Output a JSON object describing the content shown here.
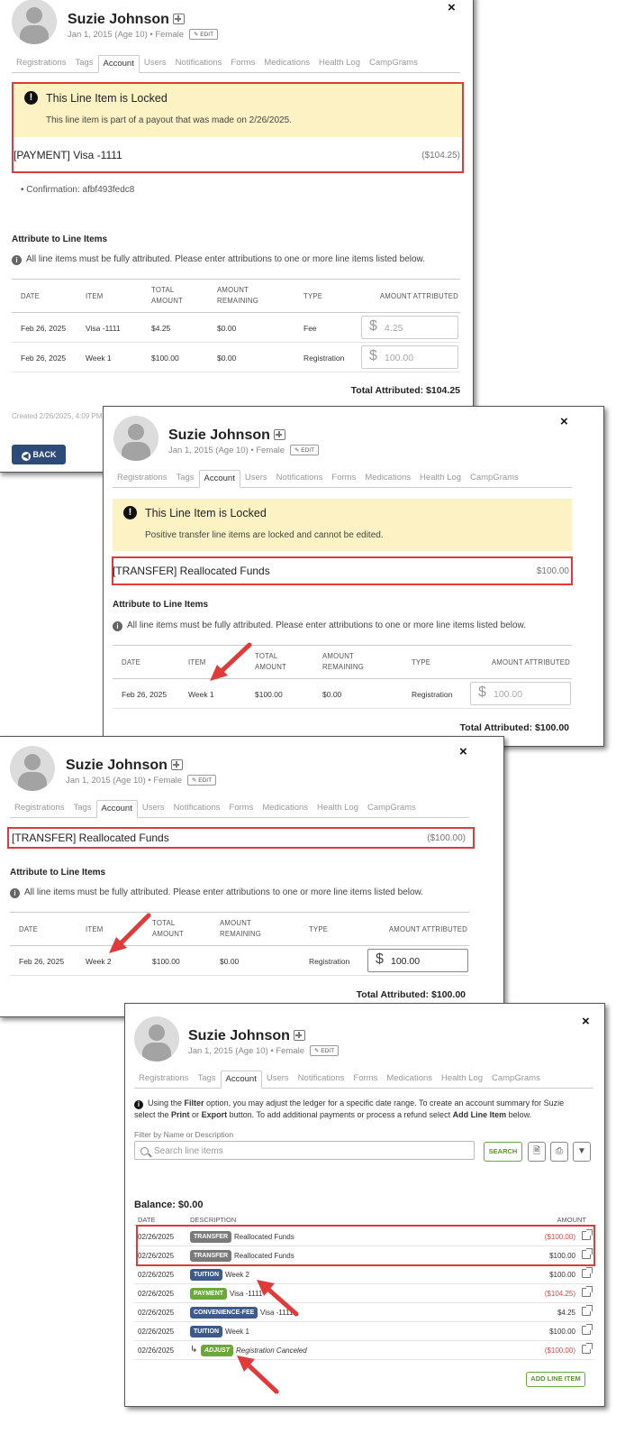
{
  "person": {
    "name": "Suzie Johnson",
    "meta": "Jan 1, 2015 (Age 10) • Female",
    "edit_label": "EDIT"
  },
  "tabs": [
    "Registrations",
    "Tags",
    "Account",
    "Users",
    "Notifications",
    "Forms",
    "Medications",
    "Health Log",
    "CampGrams"
  ],
  "close_label": "×",
  "attribute_title": "Attribute to Line Items",
  "attribute_note": "All line items must be fully attributed. Please enter attributions to one or more line items listed below.",
  "table_headers": {
    "date": "DATE",
    "item": "ITEM",
    "total_amount": [
      "TOTAL",
      "AMOUNT"
    ],
    "amount_remaining": [
      "AMOUNT",
      "REMAINING"
    ],
    "type": "TYPE",
    "amount_attributed": "AMOUNT ATTRIBUTED"
  },
  "panel1": {
    "locked_title": "This Line Item is Locked",
    "locked_message": "This line item is part of a payout that was made on 2/26/2025.",
    "line_item": "[PAYMENT] Visa -1111",
    "line_amount": "($104.25)",
    "confirmation": "• Confirmation: afbf493fedc8",
    "rows": [
      {
        "date": "Feb 26, 2025",
        "item": "Visa -1111",
        "total": "$4.25",
        "remaining": "$0.00",
        "type": "Fee",
        "attributed": "4.25"
      },
      {
        "date": "Feb 26, 2025",
        "item": "Week 1",
        "total": "$100.00",
        "remaining": "$0.00",
        "type": "Registration",
        "attributed": "100.00"
      }
    ],
    "total_attributed": "Total Attributed: $104.25",
    "created": "Created 2/26/2025, 4:09 PM",
    "back_label": "BACK"
  },
  "panel2": {
    "locked_title": "This Line Item is Locked",
    "locked_message": "Positive transfer line items are locked and cannot be edited.",
    "line_item": "[TRANSFER] Reallocated Funds",
    "line_amount": "$100.00",
    "rows": [
      {
        "date": "Feb 26, 2025",
        "item": "Week 1",
        "total": "$100.00",
        "remaining": "$0.00",
        "type": "Registration",
        "attributed": "100.00"
      }
    ],
    "total_attributed": "Total Attributed: $100.00"
  },
  "panel3": {
    "line_item": "[TRANSFER] Reallocated Funds",
    "line_amount": "($100.00)",
    "rows": [
      {
        "date": "Feb 26, 2025",
        "item": "Week 2",
        "total": "$100.00",
        "remaining": "$0.00",
        "type": "Registration",
        "attributed": "100.00"
      }
    ],
    "total_attributed": "Total Attributed: $100.00"
  },
  "panel4": {
    "note_parts": {
      "a": "Using the ",
      "b": "Filter",
      "c": " option, you may adjust the ledger for a specific date range. To create an account summary for Suzie select the ",
      "d": "Print",
      "e": " or ",
      "f": "Export",
      "g": " button. To add additional payments or process a refund select ",
      "h": "Add Line Item",
      "i": " below."
    },
    "filter_label": "Filter by Name or Description",
    "search_placeholder": "Search line items",
    "search_button": "SEARCH",
    "balance": "Balance: $0.00",
    "headers": {
      "date": "DATE",
      "description": "DESCRIPTION",
      "amount": "AMOUNT"
    },
    "rows": [
      {
        "date": "02/26/2025",
        "tag": "TRANSFER",
        "tag_color": "#7a7a7a",
        "description": "Reallocated Funds",
        "amount": "($100.00)",
        "negative": true
      },
      {
        "date": "02/26/2025",
        "tag": "TRANSFER",
        "tag_color": "#7a7a7a",
        "description": "Reallocated Funds",
        "amount": "$100.00",
        "negative": false
      },
      {
        "date": "02/26/2025",
        "tag": "TUITION",
        "tag_color": "#3d5a8c",
        "description": "Week 2",
        "amount": "$100.00",
        "negative": false
      },
      {
        "date": "02/26/2025",
        "tag": "PAYMENT",
        "tag_color": "#6aa83a",
        "description": "Visa -1111",
        "amount": "($104.25)",
        "negative": true
      },
      {
        "date": "02/26/2025",
        "tag": "CONVENIENCE-FEE",
        "tag_color": "#3d5a8c",
        "description": "Visa -1111",
        "amount": "$4.25",
        "negative": false
      },
      {
        "date": "02/26/2025",
        "tag": "TUITION",
        "tag_color": "#3d5a8c",
        "description": "Week 1",
        "amount": "$100.00",
        "negative": false
      },
      {
        "date": "02/26/2025",
        "tag": "ADJUST",
        "tag_color": "#6aa83a",
        "description": "Registration Canceled",
        "amount": "($100.00)",
        "negative": true
      }
    ],
    "add_button": "ADD LINE ITEM"
  },
  "colors": {
    "red_highlight": "#e03a3a",
    "lock_banner": "#fdf2c4",
    "back_button": "#2c4a7a",
    "green": "#6aa83a"
  }
}
